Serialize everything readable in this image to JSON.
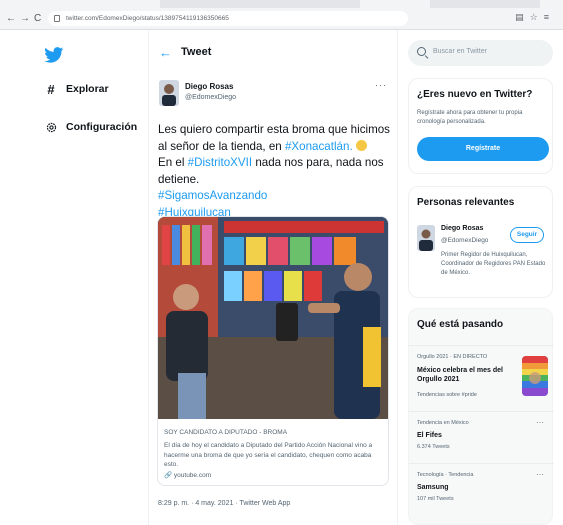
{
  "browser": {
    "url": "twitter.com/EdomexDiego/status/1389754119136350665",
    "back": "←",
    "forward": "→",
    "reload": "C"
  },
  "nav": {
    "explore": "Explorar",
    "settings": "Configuración"
  },
  "header": {
    "title": "Tweet"
  },
  "tweet": {
    "author_name": "Diego Rosas",
    "author_handle": "@EdomexDiego",
    "text_1": "Les quiero compartir esta broma que hicimos al señor de la tienda, en ",
    "link_1": "#Xonacatlán.",
    "text_2": "En el ",
    "link_2": "#DistritoXVII",
    "text_3": " nada nos para, nada nos detiene.",
    "link_3": "#SigamosAvanzando",
    "link_4": "#Huixquilucan",
    "card": {
      "title": "SOY CANDIDATO A DIPUTADO - BROMA",
      "description": "El día de hoy el candidato a Diputado del Partido Acción Nacional vino a hacerme una broma de que yo sería el candidato, chequen como acaba esto.",
      "link": "youtube.com"
    },
    "meta": "8:29 p. m. · 4 may. 2021 · Twitter Web App"
  },
  "search": {
    "placeholder": "Buscar en Twitter"
  },
  "signup": {
    "title": "¿Eres nuevo en Twitter?",
    "description": "Regístrate ahora para obtener tu propia cronología personalizada.",
    "button": "Regístrate"
  },
  "relevant": {
    "title": "Personas relevantes",
    "name": "Diego Rosas",
    "handle": "@EdomexDiego",
    "follow": "Seguir",
    "bio": "Primer Regidor de Huixquilucan, Coordinador de Regidores PAN Estado de México."
  },
  "happening": {
    "title": "Qué está pasando",
    "trends": [
      {
        "category": "Orgullo 2021 · EN DIRECTO",
        "title": "México celebra el mes del Orgullo 2021",
        "count": "Tendencias sobre #pride"
      },
      {
        "category": "Tendencia en México",
        "title": "El Fifes",
        "count": "6.374 Tweets"
      },
      {
        "category": "Tecnología · Tendencia",
        "title": "Samsung",
        "count": "107 mil Tweets"
      }
    ]
  },
  "colors": {
    "accent": "#1d9bf0",
    "text": "#0f1419",
    "muted": "#536471"
  }
}
